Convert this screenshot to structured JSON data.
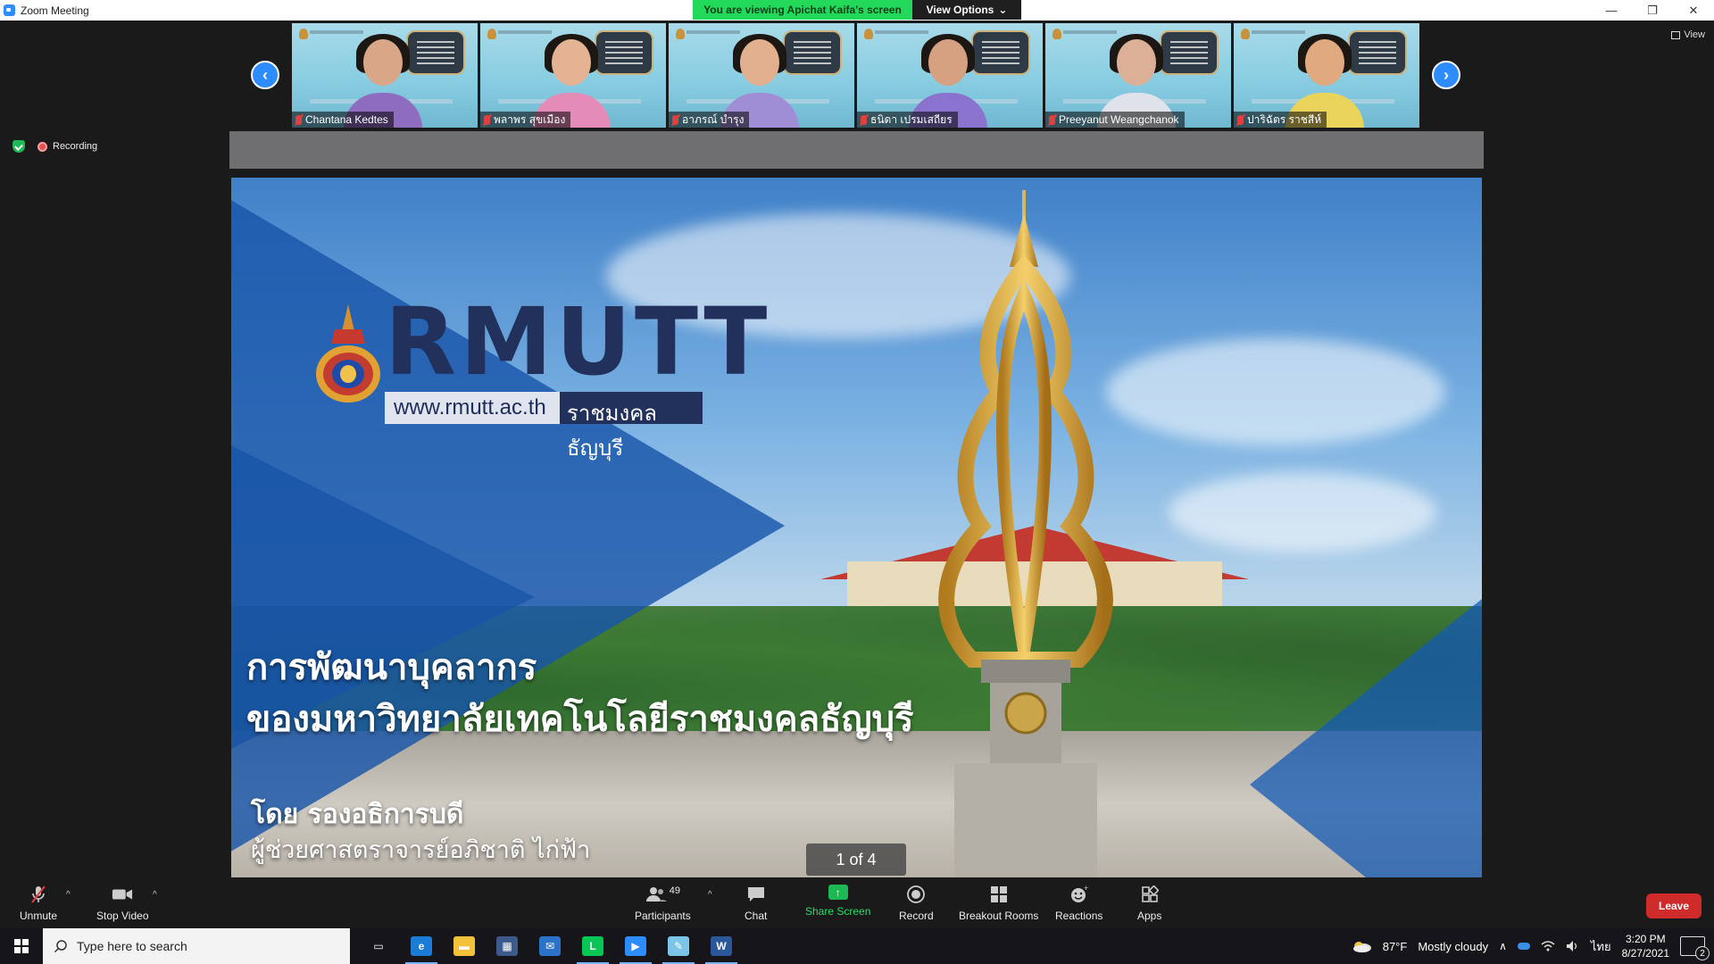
{
  "window": {
    "title": "Zoom Meeting",
    "minimize": "—",
    "restore": "❐",
    "close": "✕"
  },
  "share_banner": {
    "text": "You are viewing Apichat Kaifa's screen",
    "options_label": "View Options",
    "options_caret": "⌄"
  },
  "view_button": {
    "label": "View"
  },
  "status": {
    "recording_label": "Recording"
  },
  "gallery": {
    "prev_arrow": "‹",
    "next_arrow": "›",
    "participants": [
      {
        "name": "Chantana Kedtes",
        "shirt": "#8e6cc0",
        "skin": "#d9a787"
      },
      {
        "name": "พลาพร สุขเมือง",
        "shirt": "#e58bb7",
        "skin": "#e3b393"
      },
      {
        "name": "อาภรณ์ บำรุง",
        "shirt": "#9f8ed6",
        "skin": "#e2b08f"
      },
      {
        "name": "ธนิดา เปรมเสถียร",
        "shirt": "#8a73cf",
        "skin": "#d6a181"
      },
      {
        "name": "Preeyanut Weangchanok",
        "shirt": "#dfe2ea",
        "skin": "#dcb096"
      },
      {
        "name": "ปาริฉัตร ราชสีห์",
        "shirt": "#ead35a",
        "skin": "#e0a97f"
      }
    ]
  },
  "slide": {
    "brand": "RMUTT",
    "url": "www.rmutt.ac.th",
    "brand_th": "ราชมงคลธัญบุรี",
    "headline_line1": "การพัฒนาบุคลากร",
    "headline_line2": "ของมหาวิทยาลัยเทคโนโลยีราชมงคลธัญบุรี",
    "by_line1": "โดย รองอธิการบดี",
    "by_line2": "ผู้ช่วยศาสตราจารย์อภิชาติ ไก่ฟ้า",
    "page_indicator": "1 of 4"
  },
  "toolbar": {
    "unmute": "Unmute",
    "stop_video": "Stop Video",
    "participants": "Participants",
    "participants_count": "49",
    "chat": "Chat",
    "share_screen": "Share Screen",
    "record": "Record",
    "breakout_rooms": "Breakout Rooms",
    "reactions": "Reactions",
    "apps": "Apps",
    "leave": "Leave",
    "caret": "^"
  },
  "taskbar": {
    "search_placeholder": "Type here to search",
    "weather_temp": "87°F",
    "weather_desc": "Mostly cloudy",
    "language": "ไทย",
    "time": "3:20 PM",
    "date": "8/27/2021",
    "notification_count": "2",
    "apps": [
      {
        "name": "task-view",
        "glyph": "▭",
        "bg": "transparent"
      },
      {
        "name": "edge",
        "glyph": "e",
        "bg": "#1d7bd8"
      },
      {
        "name": "file-explorer",
        "glyph": "▬",
        "bg": "#f2c23a"
      },
      {
        "name": "store",
        "glyph": "▦",
        "bg": "#3d5a8c"
      },
      {
        "name": "mail",
        "glyph": "✉",
        "bg": "#2a73c9"
      },
      {
        "name": "line",
        "glyph": "L",
        "bg": "#06c755"
      },
      {
        "name": "zoom",
        "glyph": "▶",
        "bg": "#2d8cff"
      },
      {
        "name": "notepad",
        "glyph": "✎",
        "bg": "#7cc4e8"
      },
      {
        "name": "word",
        "glyph": "W",
        "bg": "#2b579a"
      }
    ]
  },
  "colors": {
    "zoom_blue": "#2d8cff",
    "share_green": "#23d959",
    "leave_red": "#d02b2b"
  }
}
